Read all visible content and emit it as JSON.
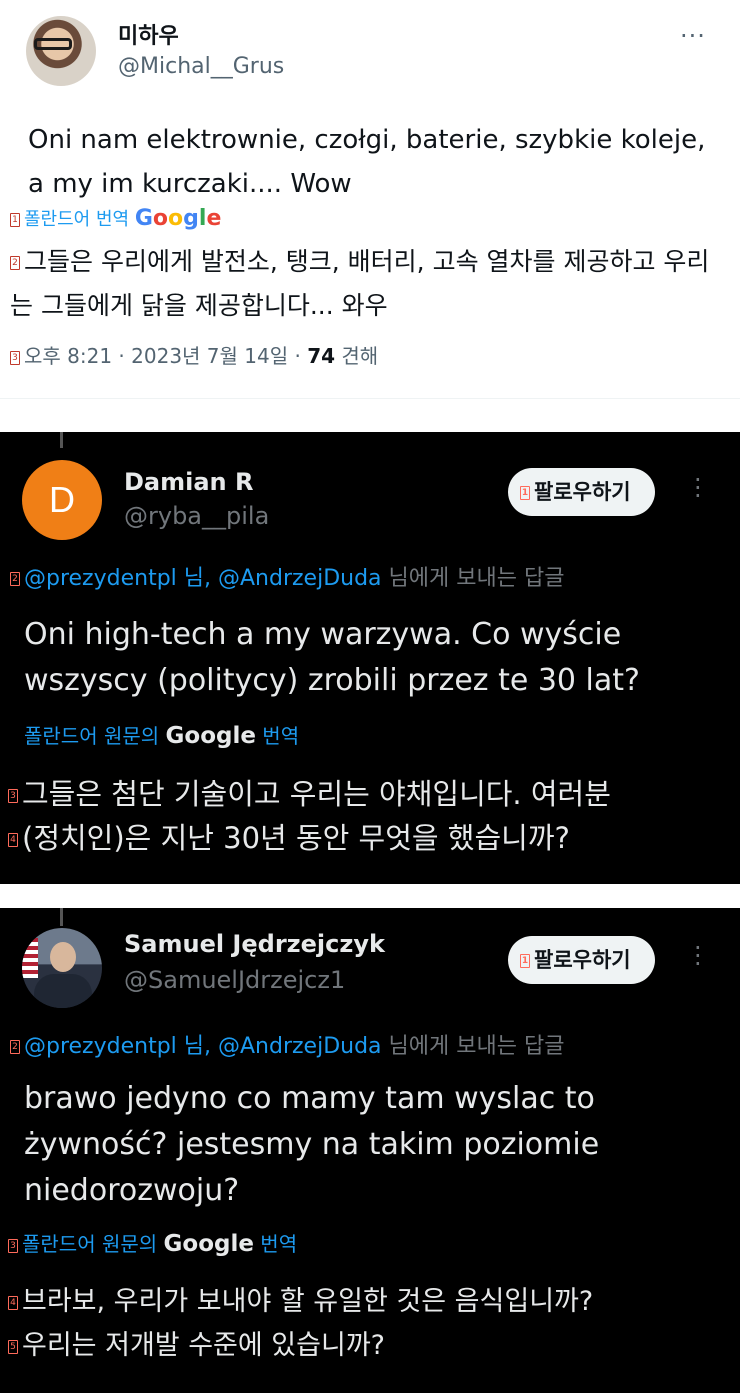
{
  "tweet1": {
    "display_name": "미하우",
    "handle": "@Michal__Grus",
    "more_icon": "···",
    "text": "Oni nam elektrownie, czołgi, baterie, szybkie koleje, a my im kurczaki.... Wow",
    "marker1": "1",
    "translate_label": "폴란드어 번역",
    "google_word": "Google",
    "marker2": "2",
    "translation": "그들은 우리에게 발전소, 탱크, 배터리, 고속 열차를 제공하고 우리는 그들에게 닭을 제공합니다... 와우",
    "marker3": "3",
    "timestamp": "오후 8:21 · 2023년 7월 14일 · ",
    "views_count": "74",
    "views_label": " 견해"
  },
  "tweet2": {
    "avatar_letter": "D",
    "display_name": "Damian R",
    "handle": "@ryba__pila",
    "follow_marker": "1",
    "follow_label": "팔로우하기",
    "marker2": "2",
    "reply_mention1": "@prezydentpl 님, ",
    "reply_mention2": "@AndrzejDuda",
    "reply_suffix": " 님에게 보내는 답글",
    "text": "Oni high-tech a my warzywa. Co wyście wszyscy (politycy) zrobili przez te 30 lat?",
    "translate_prefix": "폴란드어 원문의 ",
    "google_word": "Google",
    "translate_suffix": " 번역",
    "marker3": "3",
    "translation_line1": "그들은 첨단 기술이고 우리는 야채입니다. 여러분",
    "marker4": "4",
    "translation_line2": "(정치인)은 지난 30년 동안 무엇을 했습니까?"
  },
  "tweet3": {
    "display_name": "Samuel Jędrzejczyk",
    "handle": "@SamuelJdrzejcz1",
    "follow_marker": "1",
    "follow_label": "팔로우하기",
    "marker2": "2",
    "reply_mention1": "@prezydentpl 님, ",
    "reply_mention2": "@AndrzejDuda",
    "reply_suffix": " 님에게 보내는 답글",
    "text": "brawo jedyno co mamy tam wyslac to żywność?  jestesmy na takim poziomie niedorozwoju?",
    "marker3": "3",
    "translate_prefix": "폴란드어 원문의 ",
    "google_word": "Google",
    "translate_suffix": " 번역",
    "marker4": "4",
    "translation_line1": "브라보, 우리가 보내야 할 유일한 것은 음식입니까?",
    "marker5": "5",
    "translation_line2": "우리는 저개발 수준에 있습니까?"
  },
  "colors": {
    "link_blue": "#1d9bf0",
    "dark_bg": "#000000",
    "avatar_orange": "#f07f16",
    "marker_red": "#c0392b"
  }
}
